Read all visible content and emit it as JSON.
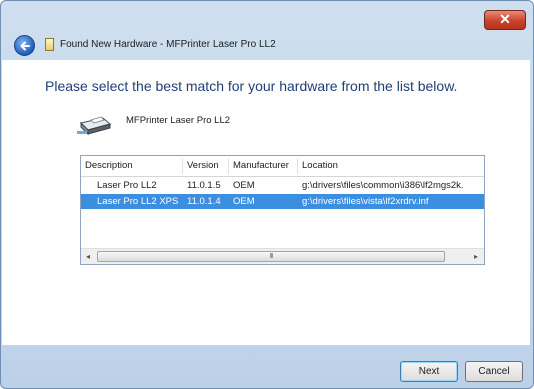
{
  "window": {
    "title": "Found New Hardware - MFPrinter Laser Pro LL2",
    "close_glyph": "✕"
  },
  "heading": "Please select the best match for your hardware from the list below.",
  "device_name": "MFPrinter Laser Pro LL2",
  "list": {
    "columns": [
      "Description",
      "Version",
      "Manufacturer",
      "Location"
    ],
    "rows": [
      {
        "description": "Laser Pro LL2",
        "version": "11.0.1.5",
        "manufacturer": "OEM",
        "location": "g:\\drivers\\files\\common\\i386\\lf2mgs2k.",
        "selected": false
      },
      {
        "description": "Laser Pro LL2 XPS",
        "version": "11.0.1.4",
        "manufacturer": "OEM",
        "location": "g:\\drivers\\files\\vista\\lf2xrdrv.inf",
        "selected": true
      }
    ],
    "scroll_left": "◂",
    "scroll_right": "▸",
    "scroll_grip": "III"
  },
  "buttons": {
    "next": "Next",
    "cancel": "Cancel"
  },
  "icons": [
    "back-arrow-icon",
    "hardware-icon",
    "printer-icon",
    "close-icon"
  ],
  "colors": {
    "frame": "#c5d8ec",
    "heading": "#1f3f78",
    "selection": "#3c8ee0",
    "close_button": "#c9432b"
  }
}
